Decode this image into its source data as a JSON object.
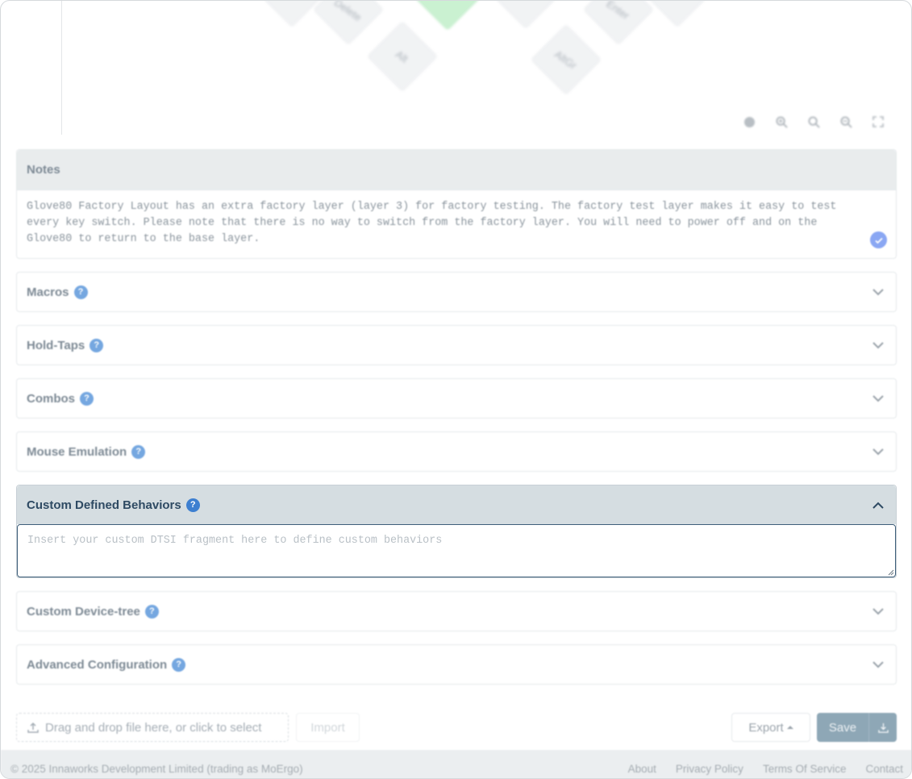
{
  "preview": {
    "keys": [
      {
        "label": "",
        "highlight": false
      },
      {
        "label": "Delete",
        "highlight": false
      },
      {
        "label": "Alt",
        "highlight": false
      },
      {
        "label": "",
        "highlight": true
      },
      {
        "label": "",
        "highlight": false
      },
      {
        "label": "AltGr",
        "highlight": false
      },
      {
        "label": "Enter",
        "highlight": false
      },
      {
        "label": "",
        "highlight": false
      }
    ],
    "tools": [
      "reset-dot-icon",
      "zoom-in-icon",
      "zoom-reset-icon",
      "zoom-out-icon",
      "fullscreen-icon"
    ]
  },
  "notes": {
    "title": "Notes",
    "text": "Glove80 Factory Layout has an extra factory layer (layer 3) for factory testing. The factory test layer makes it easy to test\nevery key switch. Please note that there is no way to switch from the factory layer. You will need to power off and on the\nGlove80 to return to the base layer."
  },
  "sections": [
    {
      "title": "Macros"
    },
    {
      "title": "Hold-Taps"
    },
    {
      "title": "Combos"
    },
    {
      "title": "Mouse Emulation"
    }
  ],
  "active_section": {
    "title": "Custom Defined Behaviors",
    "placeholder": "Insert your custom DTSI fragment here to define custom behaviors",
    "value": ""
  },
  "sections_after": [
    {
      "title": "Custom Device-tree"
    },
    {
      "title": "Advanced Configuration"
    }
  ],
  "actions": {
    "dropzone_label": "Drag and drop file here, or click to select",
    "import_label": "Import",
    "export_label": "Export",
    "save_label": "Save"
  },
  "footer": {
    "copyright": "© 2025 Innaworks Development Limited (trading as MoErgo)",
    "links": [
      "About",
      "Privacy Policy",
      "Terms Of Service",
      "Contact"
    ]
  },
  "colors": {
    "accent": "#4f8fd8",
    "save_bg": "#6f8fa2",
    "active_header": "#d5dde1"
  }
}
